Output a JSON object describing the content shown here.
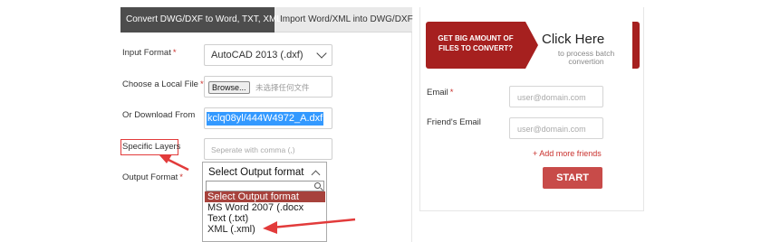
{
  "tabs": {
    "active": "Convert DWG/DXF to Word, TXT, XML",
    "inactive": "Import Word/XML into DWG/DXF"
  },
  "form": {
    "input_format_label": "Input Format",
    "input_format_value": "AutoCAD 2013 (.dxf)",
    "local_file_label": "Choose a Local File",
    "browse_label": "Browse...",
    "no_file_text": "未选择任何文件",
    "download_label": "Or Download From",
    "download_value": "kclq08yl/444W4972_A.dxf",
    "layers_label": "Specific Layers",
    "layers_placeholder": "Seperate with comma (,)",
    "output_label": "Output Format",
    "required_mark": "*"
  },
  "output_dropdown": {
    "selected": "Select Output format",
    "options": [
      "Select Output format",
      "MS Word 2007 (.docx",
      "Text (.txt)",
      "XML (.xml)"
    ]
  },
  "sidebar": {
    "banner_text": "GET BIG AMOUNT OF FILES TO CONVERT?",
    "click_here": "Click Here",
    "click_sub": "to process batch convertion",
    "email_label": "Email",
    "email_placeholder": "user@domain.com",
    "friend_label": "Friend's Email",
    "friend_placeholder": "user@domain.com",
    "add_more": "+ Add more friends",
    "start": "START",
    "required_mark": "*"
  },
  "colors": {
    "accent": "#a6201f",
    "start_button": "#c84b49",
    "annotation": "#e23b3b"
  }
}
